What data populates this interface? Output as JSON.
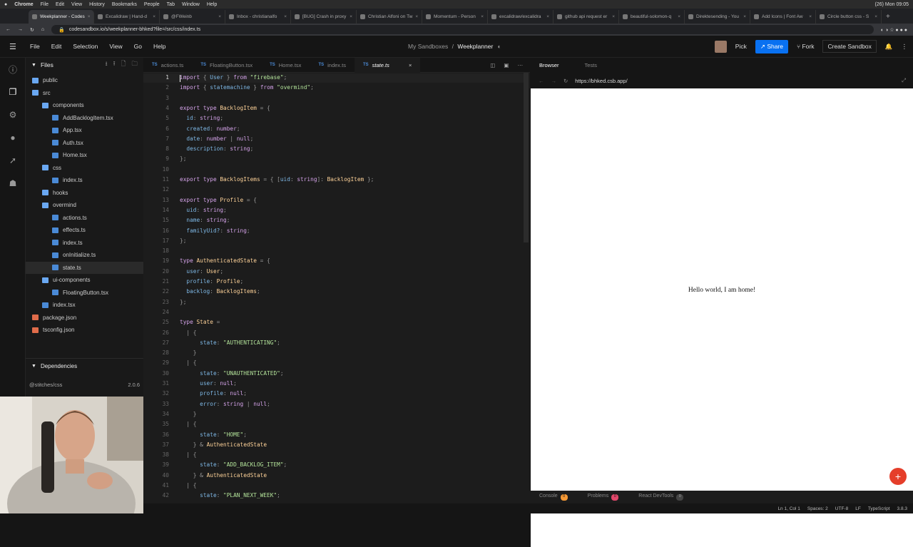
{
  "macmenu": {
    "apple": "",
    "items": [
      "Chrome",
      "File",
      "Edit",
      "View",
      "History",
      "Bookmarks",
      "People",
      "Tab",
      "Window",
      "Help"
    ],
    "clock": "(26) Mon 09:05"
  },
  "chrome_tabs": [
    "Weekplanner - Codes",
    "Excalidraw | Hand-d",
    "@FWeinb",
    "Inbox - christianalfo",
    "[BUG] Crash in proxy",
    "Christian Alfoni on Tw",
    "Momentum - Person",
    "excalidraw/excalidra",
    "github api request er",
    "beautiful-solomon-q",
    "Direktesending - You",
    "Add Icons | Font Aw",
    "Circle button css - S"
  ],
  "omnibar": {
    "url": "codesandbox.io/s/weekplanner-bhked?file=/src/css/index.ts"
  },
  "header": {
    "menu": [
      "File",
      "Edit",
      "Selection",
      "View",
      "Go",
      "Help"
    ],
    "crumb_parent": "My Sandboxes",
    "crumb_sep": "/",
    "sandbox_name": "Weekplanner",
    "pick": "Pick",
    "share": "Share",
    "fork": "Fork",
    "create": "Create Sandbox"
  },
  "explorer": {
    "title": "Files",
    "tree": [
      {
        "name": "public",
        "depth": 0,
        "kind": "folder"
      },
      {
        "name": "src",
        "depth": 0,
        "kind": "folder"
      },
      {
        "name": "components",
        "depth": 1,
        "kind": "folder"
      },
      {
        "name": "AddBacklogItem.tsx",
        "depth": 2,
        "kind": "file"
      },
      {
        "name": "App.tsx",
        "depth": 2,
        "kind": "file"
      },
      {
        "name": "Auth.tsx",
        "depth": 2,
        "kind": "file"
      },
      {
        "name": "Home.tsx",
        "depth": 2,
        "kind": "file"
      },
      {
        "name": "css",
        "depth": 1,
        "kind": "folder"
      },
      {
        "name": "index.ts",
        "depth": 2,
        "kind": "file"
      },
      {
        "name": "hooks",
        "depth": 1,
        "kind": "folder"
      },
      {
        "name": "overmind",
        "depth": 1,
        "kind": "folder"
      },
      {
        "name": "actions.ts",
        "depth": 2,
        "kind": "file"
      },
      {
        "name": "effects.ts",
        "depth": 2,
        "kind": "file"
      },
      {
        "name": "index.ts",
        "depth": 2,
        "kind": "file"
      },
      {
        "name": "onInitialize.ts",
        "depth": 2,
        "kind": "file"
      },
      {
        "name": "state.ts",
        "depth": 2,
        "kind": "file",
        "selected": true
      },
      {
        "name": "ui-components",
        "depth": 1,
        "kind": "folder"
      },
      {
        "name": "FloatingButton.tsx",
        "depth": 2,
        "kind": "file"
      },
      {
        "name": "index.tsx",
        "depth": 1,
        "kind": "file"
      },
      {
        "name": "package.json",
        "depth": 0,
        "kind": "json"
      },
      {
        "name": "tsconfig.json",
        "depth": 0,
        "kind": "json"
      }
    ],
    "deps_title": "Dependencies",
    "dep_name": "@stitches/css",
    "dep_version": "2.0.6"
  },
  "editor_tabs": [
    {
      "label": "actions.ts"
    },
    {
      "label": "FloatingButton.tsx"
    },
    {
      "label": "Home.tsx"
    },
    {
      "label": "index.ts"
    },
    {
      "label": "state.ts",
      "active": true
    }
  ],
  "code_lines": [
    [
      [
        "kw",
        "import"
      ],
      [
        "op",
        " { "
      ],
      [
        "pr",
        "User"
      ],
      [
        "op",
        " } "
      ],
      [
        "kw",
        "from"
      ],
      [
        "str",
        " \"firebase\""
      ],
      [
        "op",
        ";"
      ]
    ],
    [
      [
        "kw",
        "import"
      ],
      [
        "op",
        " { "
      ],
      [
        "pr",
        "statemachine"
      ],
      [
        "op",
        " } "
      ],
      [
        "kw",
        "from"
      ],
      [
        "str",
        " \"overmind\""
      ],
      [
        "op",
        ";"
      ]
    ],
    [],
    [
      [
        "kw",
        "export type "
      ],
      [
        "ty",
        "BacklogItem"
      ],
      [
        "op",
        " = {"
      ]
    ],
    [
      [
        "pr",
        "  id"
      ],
      [
        "op",
        ": "
      ],
      [
        "kw",
        "string"
      ],
      [
        "op",
        ";"
      ]
    ],
    [
      [
        "pr",
        "  created"
      ],
      [
        "op",
        ": "
      ],
      [
        "kw",
        "number"
      ],
      [
        "op",
        ";"
      ]
    ],
    [
      [
        "pr",
        "  date"
      ],
      [
        "op",
        ": "
      ],
      [
        "kw",
        "number"
      ],
      [
        "op",
        " | "
      ],
      [
        "kw",
        "null"
      ],
      [
        "op",
        ";"
      ]
    ],
    [
      [
        "pr",
        "  description"
      ],
      [
        "op",
        ": "
      ],
      [
        "kw",
        "string"
      ],
      [
        "op",
        ";"
      ]
    ],
    [
      [
        "op",
        "};"
      ]
    ],
    [],
    [
      [
        "kw",
        "export type "
      ],
      [
        "ty",
        "BacklogItems"
      ],
      [
        "op",
        " = { ["
      ],
      [
        "pr",
        "uid"
      ],
      [
        "op",
        ": "
      ],
      [
        "kw",
        "string"
      ],
      [
        "op",
        "]: "
      ],
      [
        "ty",
        "BacklogItem"
      ],
      [
        "op",
        " };"
      ]
    ],
    [],
    [
      [
        "kw",
        "export type "
      ],
      [
        "ty",
        "Profile"
      ],
      [
        "op",
        " = {"
      ]
    ],
    [
      [
        "pr",
        "  uid"
      ],
      [
        "op",
        ": "
      ],
      [
        "kw",
        "string"
      ],
      [
        "op",
        ";"
      ]
    ],
    [
      [
        "pr",
        "  name"
      ],
      [
        "op",
        ": "
      ],
      [
        "kw",
        "string"
      ],
      [
        "op",
        ";"
      ]
    ],
    [
      [
        "pr",
        "  familyUid?"
      ],
      [
        "op",
        ": "
      ],
      [
        "kw",
        "string"
      ],
      [
        "op",
        ";"
      ]
    ],
    [
      [
        "op",
        "};"
      ]
    ],
    [],
    [
      [
        "kw",
        "type "
      ],
      [
        "ty",
        "AuthenticatedState"
      ],
      [
        "op",
        " = {"
      ]
    ],
    [
      [
        "pr",
        "  user"
      ],
      [
        "op",
        ": "
      ],
      [
        "ty",
        "User"
      ],
      [
        "op",
        ";"
      ]
    ],
    [
      [
        "pr",
        "  profile"
      ],
      [
        "op",
        ": "
      ],
      [
        "ty",
        "Profile"
      ],
      [
        "op",
        ";"
      ]
    ],
    [
      [
        "pr",
        "  backlog"
      ],
      [
        "op",
        ": "
      ],
      [
        "ty",
        "BacklogItems"
      ],
      [
        "op",
        ";"
      ]
    ],
    [
      [
        "op",
        "};"
      ]
    ],
    [],
    [
      [
        "kw",
        "type "
      ],
      [
        "ty",
        "State"
      ],
      [
        "op",
        " ="
      ]
    ],
    [
      [
        "op",
        "  | {"
      ]
    ],
    [
      [
        "pr",
        "      state"
      ],
      [
        "op",
        ": "
      ],
      [
        "str",
        "\"AUTHENTICATING\""
      ],
      [
        "op",
        ";"
      ]
    ],
    [
      [
        "op",
        "    }"
      ]
    ],
    [
      [
        "op",
        "  | {"
      ]
    ],
    [
      [
        "pr",
        "      state"
      ],
      [
        "op",
        ": "
      ],
      [
        "str",
        "\"UNAUTHENTICATED\""
      ],
      [
        "op",
        ";"
      ]
    ],
    [
      [
        "pr",
        "      user"
      ],
      [
        "op",
        ": "
      ],
      [
        "kw",
        "null"
      ],
      [
        "op",
        ";"
      ]
    ],
    [
      [
        "pr",
        "      profile"
      ],
      [
        "op",
        ": "
      ],
      [
        "kw",
        "null"
      ],
      [
        "op",
        ";"
      ]
    ],
    [
      [
        "pr",
        "      error"
      ],
      [
        "op",
        ": "
      ],
      [
        "kw",
        "string"
      ],
      [
        "op",
        " | "
      ],
      [
        "kw",
        "null"
      ],
      [
        "op",
        ";"
      ]
    ],
    [
      [
        "op",
        "    }"
      ]
    ],
    [
      [
        "op",
        "  | {"
      ]
    ],
    [
      [
        "pr",
        "      state"
      ],
      [
        "op",
        ": "
      ],
      [
        "str",
        "\"HOME\""
      ],
      [
        "op",
        ";"
      ]
    ],
    [
      [
        "op",
        "    } & "
      ],
      [
        "ty",
        "AuthenticatedState"
      ]
    ],
    [
      [
        "op",
        "  | {"
      ]
    ],
    [
      [
        "pr",
        "      state"
      ],
      [
        "op",
        ": "
      ],
      [
        "str",
        "\"ADD_BACKLOG_ITEM\""
      ],
      [
        "op",
        ";"
      ]
    ],
    [
      [
        "op",
        "    } & "
      ],
      [
        "ty",
        "AuthenticatedState"
      ]
    ],
    [
      [
        "op",
        "  | {"
      ]
    ],
    [
      [
        "pr",
        "      state"
      ],
      [
        "op",
        ": "
      ],
      [
        "str",
        "\"PLAN_NEXT_WEEK\""
      ],
      [
        "op",
        ";"
      ]
    ]
  ],
  "browser": {
    "tab_browser": "Browser",
    "tab_tests": "Tests",
    "url": "https://bhked.csb.app/",
    "content": "Hello world, I am home!",
    "fab": "+"
  },
  "bottom_panel": {
    "console": "Console",
    "console_count": "0",
    "problems": "Problems",
    "problems_count": "0",
    "devtools": "React DevTools",
    "devtools_count": "0"
  },
  "statusbar": {
    "position": "Ln 1, Col 1",
    "spaces": "Spaces: 2",
    "encoding": "UTF-8",
    "eol": "LF",
    "language": "TypeScript",
    "version": "3.8.3"
  },
  "colors": {
    "accent": "#0971f1",
    "fab": "#e53e2a",
    "folder": "#6aa8f2",
    "ts": "#4a8ad6"
  }
}
